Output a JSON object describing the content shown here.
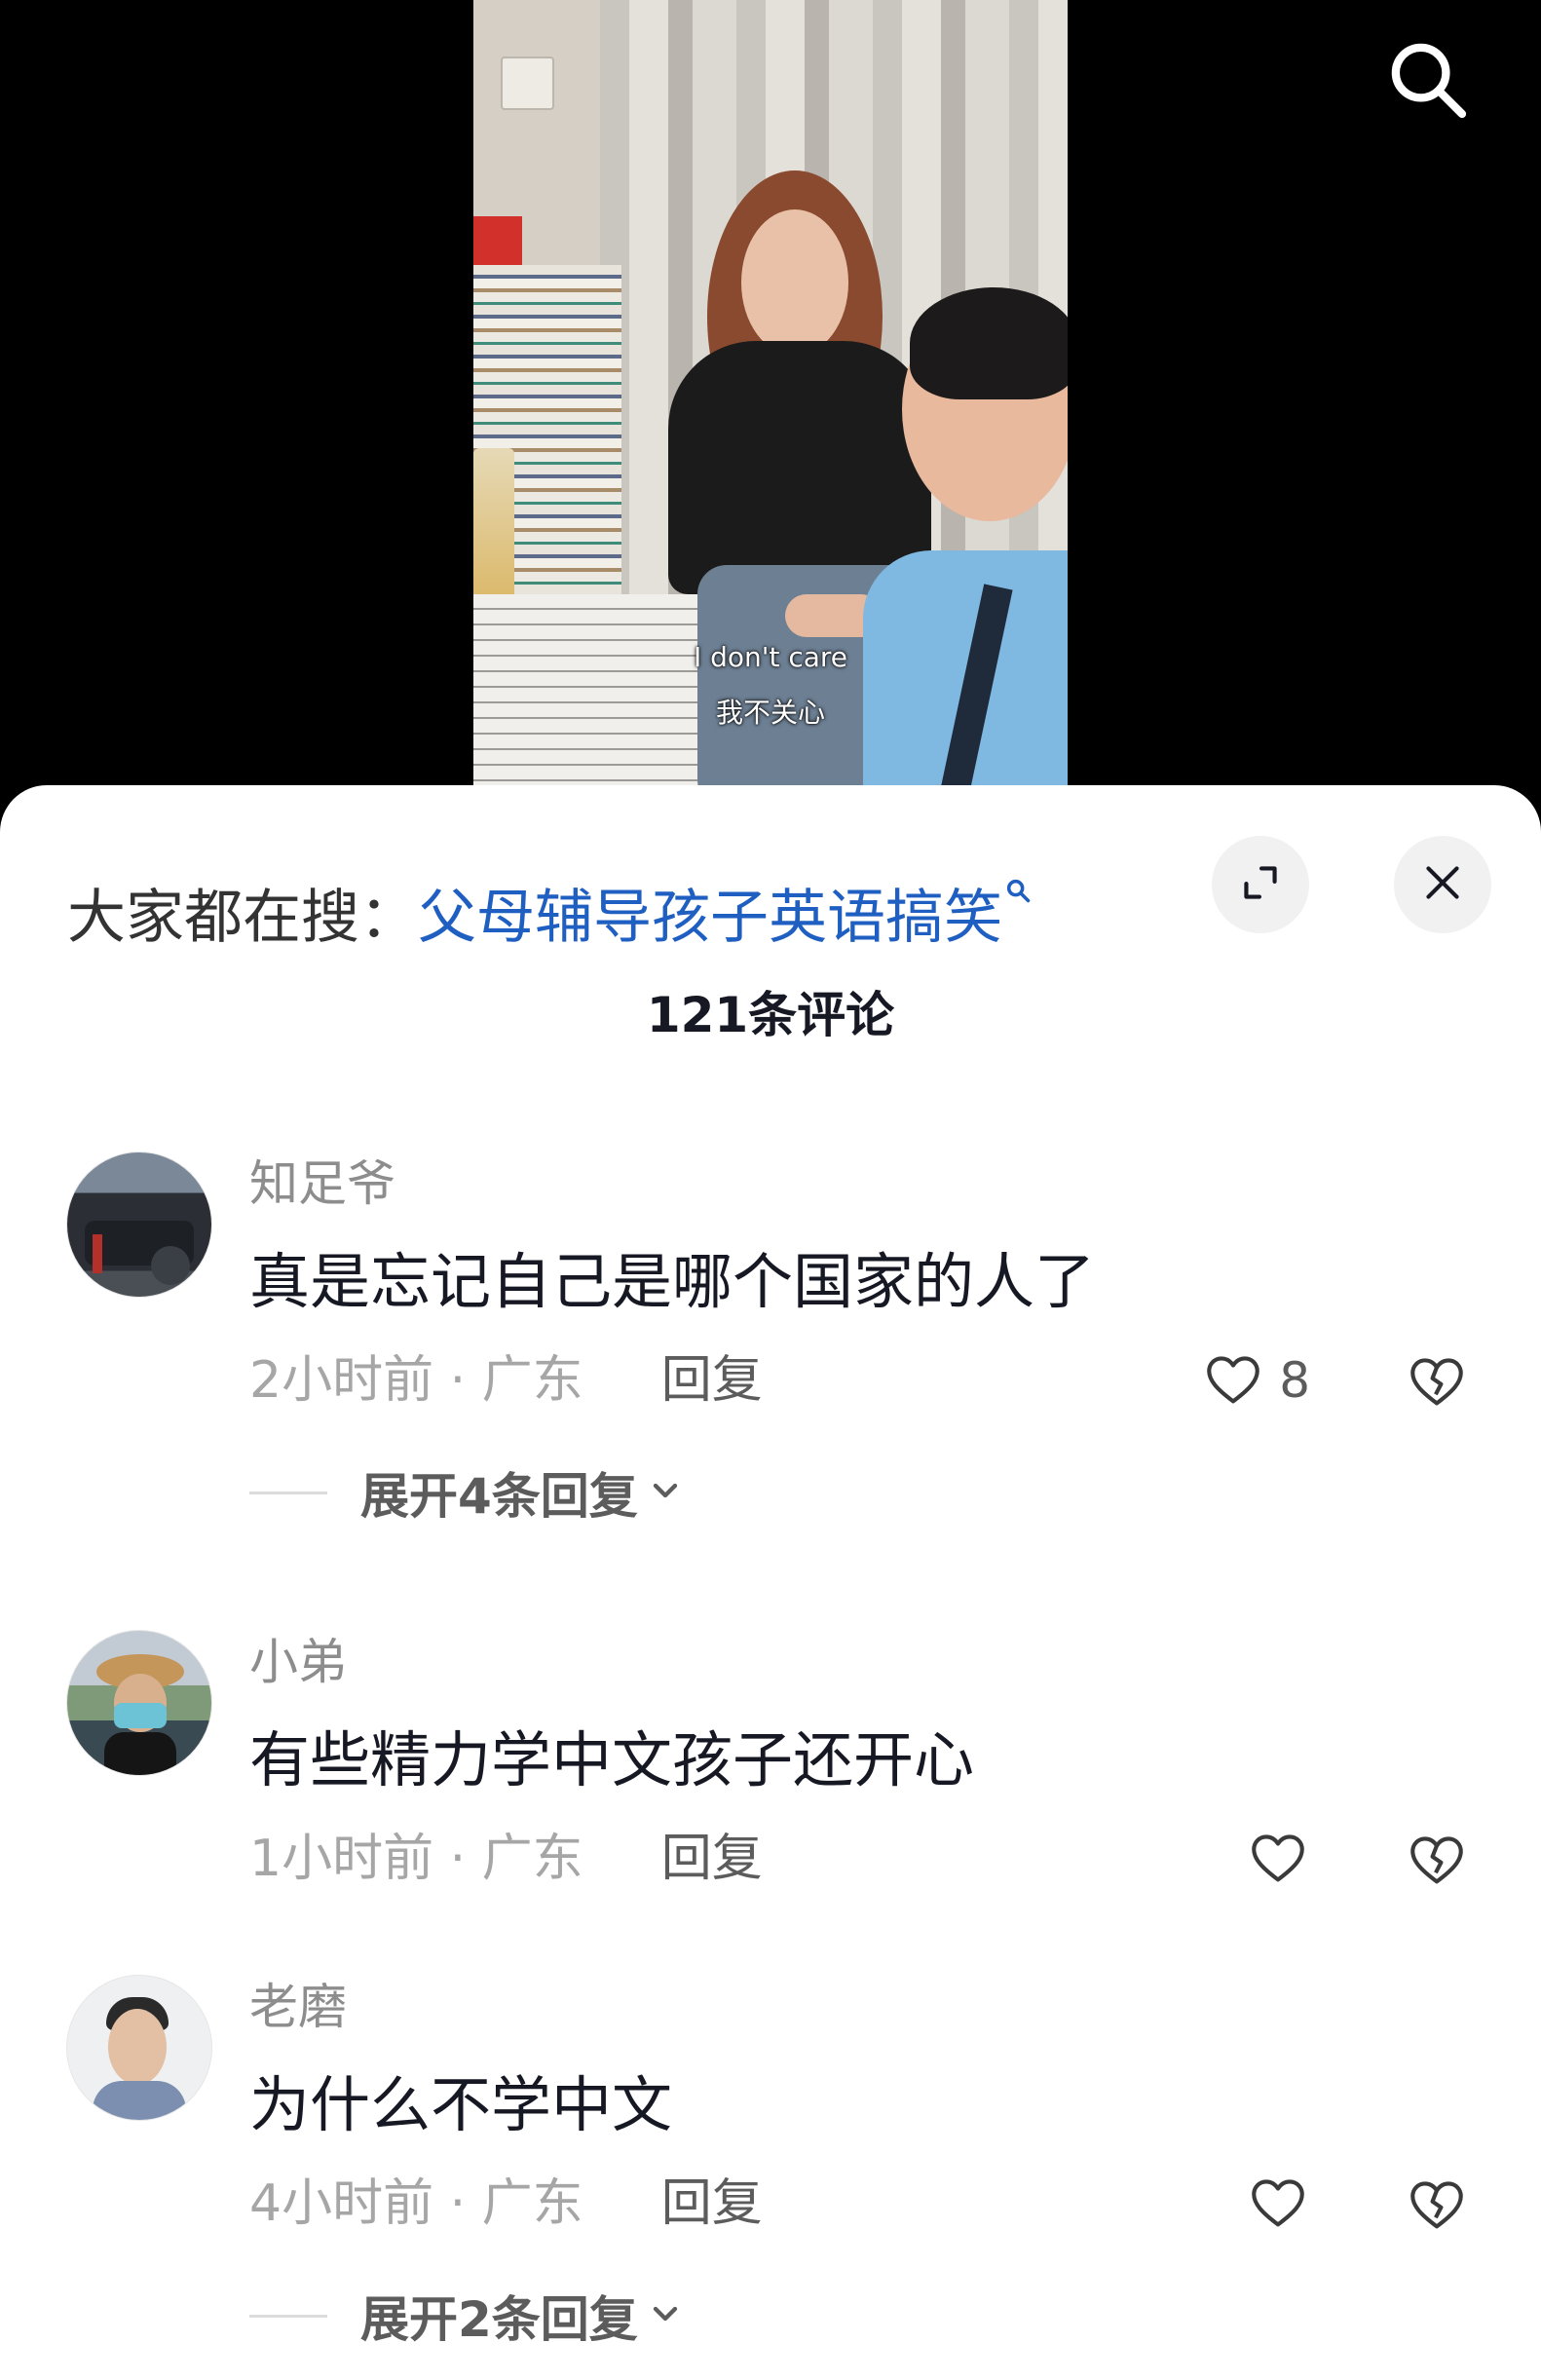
{
  "video": {
    "subtitle_en": "I don't care",
    "subtitle_zh": "我不关心"
  },
  "sheet": {
    "search_prefix": "大家都在搜：",
    "search_query": "父母辅导孩子英语搞笑",
    "comment_count": "121条评论"
  },
  "comments": [
    {
      "user": "知足爷",
      "text": "真是忘记自己是哪个国家的人了",
      "meta": "2小时前 · 广东",
      "reply": "回复",
      "likes": "8",
      "expand": "展开4条回复"
    },
    {
      "user": "小弟",
      "text": "有些精力学中文孩子还开心",
      "meta": "1小时前 · 广东",
      "reply": "回复"
    },
    {
      "user": "老磨",
      "text": "为什么不学中文",
      "meta": "4小时前 · 广东",
      "reply": "回复",
      "expand": "展开2条回复"
    }
  ],
  "icons": {
    "top_search": "search-icon",
    "query_search": "search-icon",
    "expand": "expand-icon",
    "close": "close-icon",
    "like": "heart-icon",
    "dislike": "broken-heart-icon",
    "more_replies": "chevron-down-icon"
  },
  "colors": {
    "accent": "#1f5fc1",
    "name": "#8d8d8d",
    "text": "#161823",
    "meta": "#a6a6a6",
    "action": "#5c5c5c",
    "button_bg": "#f1f1f1"
  }
}
